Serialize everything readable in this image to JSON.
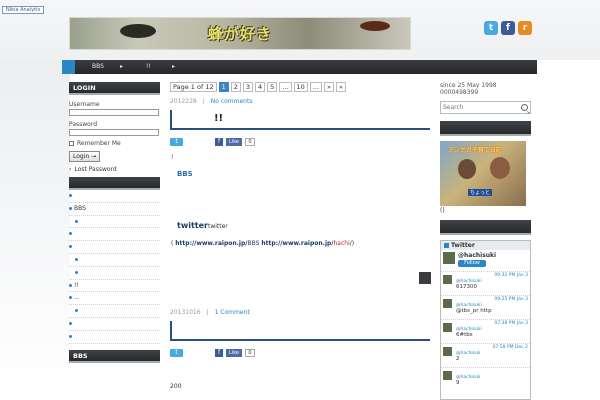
{
  "top": {
    "stats_badge": "Nikia Analytix"
  },
  "header": {
    "site_title": "蜂が好き",
    "social": {
      "twitter": "t",
      "facebook": "f",
      "rss": "r"
    }
  },
  "nav": {
    "items": [
      "BBS",
      "▸",
      "!!",
      "▸"
    ]
  },
  "left_sidebar": {
    "login": {
      "heading": "LOGIN",
      "username_label": "Username",
      "password_label": "Password",
      "remember_label": "Remember Me",
      "login_button": "Login →",
      "lost_password": "Lost Password"
    },
    "list_items": [
      "",
      "BBS",
      "",
      "",
      "",
      "",
      "",
      "!!",
      "...",
      "",
      "",
      ""
    ],
    "bottom_heading": "BBS"
  },
  "main": {
    "pager": {
      "label": "Page 1 of 12",
      "pages": [
        "1",
        "2",
        "3",
        "4",
        "5",
        "...",
        "10",
        "...",
        "»",
        "»"
      ]
    },
    "post1": {
      "date": "2012228",
      "comments": "No comments",
      "title": "!!",
      "twitter_share": "t",
      "fb_share": "f",
      "fb_like": "Like",
      "fb_count": "0",
      "para_mark": "!",
      "author_tag": "BBS",
      "twitter_word": "twitter",
      "twitter_tail": "twitter",
      "link_prefix": "(",
      "link1": "http://www.raipon.jp/",
      "link1_tail": "BBS",
      "link2": "http://www.raipon.jp/",
      "link2_red": "hachi",
      "link2_tail": "/)"
    },
    "post2": {
      "date": "20131016",
      "comments": "1 Comment",
      "twitter_share": "t",
      "fb_share": "f",
      "fb_like": "Like",
      "fb_count": "0",
      "footer_number": "200"
    }
  },
  "right_sidebar": {
    "since": "since 25 May 1998",
    "counter": "0000498399",
    "search_placeholder": "Search",
    "image_caption": "()",
    "image_overlay_text": "アシナガ子育て日記",
    "image_subcaption": "ちょっと",
    "twitter_widget": {
      "heading": "Twitter",
      "handle": "@hachisuki",
      "follow": "Follow",
      "tweets": [
        {
          "time": "09:32 PM Jan 3",
          "handle": "@hachisuki",
          "text": "617300"
        },
        {
          "time": "09:25 PM Jan 3",
          "handle": "@hachisuki",
          "text": "@tbs_pr  http"
        },
        {
          "time": "07:38 PM Jan 3",
          "handle": "@hachisuki",
          "text": "6#tbs"
        },
        {
          "time": "07:58 PM Dec 2",
          "handle": "@hachisuk",
          "text": "2"
        },
        {
          "time": "",
          "handle": "@hachisuk",
          "text": "9"
        }
      ]
    }
  },
  "colors": {
    "nav_bg": "#2b2d30",
    "accent_blue": "#2a86c6",
    "title_bar": "#2a4f82"
  }
}
